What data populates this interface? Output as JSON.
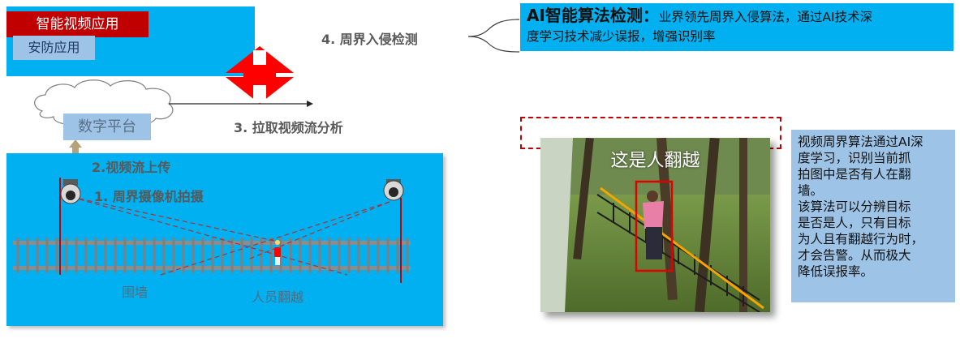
{
  "app": {
    "title": "智能视频应用",
    "subtitle": "安防应用"
  },
  "steps": {
    "step1": "1. 周界摄像机拍摄",
    "step2": "2.视频流上传",
    "step3": "3. 拉取视频流分析",
    "step4": "4. 周界入侵检测"
  },
  "platform": {
    "label": "数字平台"
  },
  "scene": {
    "wall_label": "围墙",
    "person_label": "人员翻越"
  },
  "ai_callout": {
    "title": "AI智能算法检测：",
    "desc_line1": "业界领先周界入侵算法，通过AI技术深",
    "desc_line2": "度学习技术减少误报，增强识别率"
  },
  "photo": {
    "caption": "这是人翻越"
  },
  "explanation": "视频周界算法通过AI深\n度学习，识别当前抓\n拍图中是否有人在翻\n墙。\n该算法可以分辨目标\n是否是人，只有目标\n为人且有翻越行为时，\n才会告警。从而极大\n降低误报率。",
  "colors": {
    "panel_blue": "#00b0f0",
    "light_blue": "#9dc3e6",
    "alert_red": "#c00000",
    "arrow_red": "#ff0000",
    "upload_arrow": "#b4a27a",
    "detection_line": "#f5a400"
  }
}
